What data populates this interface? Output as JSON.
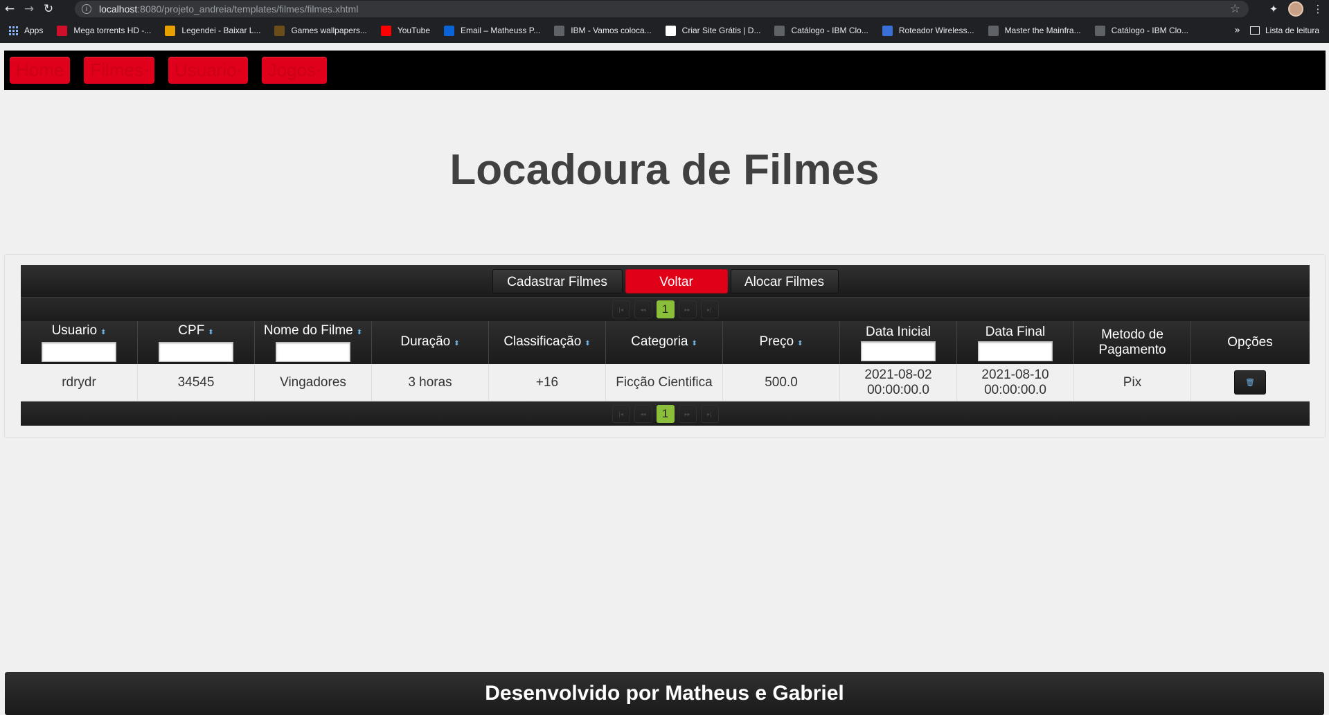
{
  "browser": {
    "url_host": "localhost",
    "url_path": ":8080/projeto_andreia/templates/filmes/filmes.xhtml",
    "bookmarks": [
      {
        "label": "Apps",
        "icon": "apps-grid-icon",
        "color": "#8ab4f8"
      },
      {
        "label": "Mega torrents HD -...",
        "icon": "hd-icon",
        "color": "#d0102a"
      },
      {
        "label": "Legendei - Baixar L...",
        "icon": "l-icon",
        "color": "#e6a000"
      },
      {
        "label": "Games wallpapers...",
        "icon": "w-icon",
        "color": "#6b4d1a"
      },
      {
        "label": "YouTube",
        "icon": "youtube-icon",
        "color": "#ff0000"
      },
      {
        "label": "Email – Matheuss P...",
        "icon": "outlook-icon",
        "color": "#0a64d8"
      },
      {
        "label": "IBM - Vamos coloca...",
        "icon": "ibm-icon",
        "color": "#5f6368"
      },
      {
        "label": "Criar Site Grátis | D...",
        "icon": "wix-icon",
        "color": "#ffffff"
      },
      {
        "label": "Catálogo - IBM Clo...",
        "icon": "cloud-icon",
        "color": "#5f6368"
      },
      {
        "label": "Roteador Wireless...",
        "icon": "router-icon",
        "color": "#3b6fd8"
      },
      {
        "label": "Master the Mainfra...",
        "icon": "ibm-icon",
        "color": "#5f6368"
      },
      {
        "label": "Catálogo - IBM Clo...",
        "icon": "cloud-icon",
        "color": "#5f6368"
      }
    ],
    "reading_list": "Lista de leitura"
  },
  "nav": {
    "items": [
      {
        "label": "Home",
        "dropdown": false
      },
      {
        "label": "Filmes",
        "dropdown": true
      },
      {
        "label": "Usuario",
        "dropdown": true
      },
      {
        "label": "Jogos",
        "dropdown": true
      }
    ]
  },
  "title": "Locadoura de Filmes",
  "toolbar": {
    "cadastrar": "Cadastrar Filmes",
    "voltar": "Voltar",
    "alocar": "Alocar Filmes"
  },
  "paginator": {
    "current_page": "1"
  },
  "table": {
    "columns": [
      {
        "label": "Usuario",
        "sortable": true,
        "filter": true
      },
      {
        "label": "CPF",
        "sortable": true,
        "filter": true
      },
      {
        "label": "Nome do Filme",
        "sortable": true,
        "filter": true
      },
      {
        "label": "Duração",
        "sortable": true,
        "filter": false
      },
      {
        "label": "Classificação",
        "sortable": true,
        "filter": false
      },
      {
        "label": "Categoria",
        "sortable": true,
        "filter": false
      },
      {
        "label": "Preço",
        "sortable": true,
        "filter": false
      },
      {
        "label": "Data Inicial",
        "sortable": false,
        "filter": true
      },
      {
        "label": "Data Final",
        "sortable": false,
        "filter": true
      },
      {
        "label": "Metodo de Pagamento",
        "sortable": false,
        "filter": false
      },
      {
        "label": "Opções",
        "sortable": false,
        "filter": false
      }
    ],
    "rows": [
      [
        "rdrydr",
        "34545",
        "Vingadores",
        "3 horas",
        "+16",
        "Ficção Cientifica",
        "500.0",
        "2021-08-02 00:00:00.0",
        "2021-08-10 00:00:00.0",
        "Pix"
      ]
    ]
  },
  "footer": "Desenvolvido por Matheus e Gabriel",
  "colors": {
    "accent_red": "#e0001b",
    "page_active": "#8bbf3a",
    "sort_icon": "#6fb3e6"
  }
}
